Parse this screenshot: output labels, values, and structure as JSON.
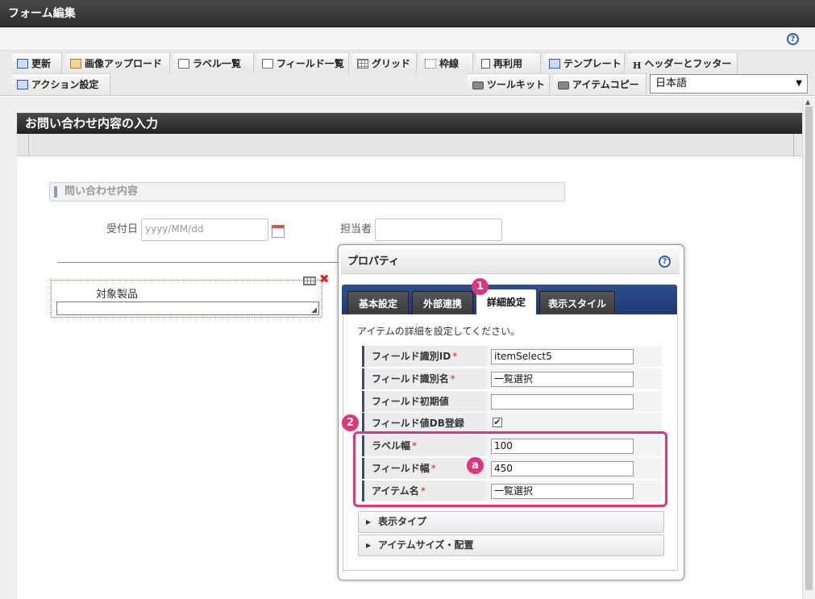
{
  "window": {
    "title": "フォーム編集"
  },
  "toolbar": {
    "row1": [
      "更新",
      "画像アップロード",
      "ラベル一覧",
      "フィールド一覧",
      "グリッド",
      "枠線",
      "再利用",
      "テンプレート",
      "ヘッダーとフッター"
    ],
    "row2_left": [
      "アクション設定"
    ],
    "row2_right": [
      "ツールキット",
      "アイテムコピー"
    ],
    "header_footer_glyph": "H",
    "language": "日本語"
  },
  "form": {
    "title": "お問い合わせ内容の入力",
    "section_title": "問い合わせ内容",
    "received_date_label": "受付日",
    "received_date_placeholder": "yyyy/MM/dd",
    "assignee_label": "担当者",
    "item_label": "対象製品"
  },
  "properties": {
    "title": "プロパティ",
    "tabs": [
      "基本設定",
      "外部連携",
      "詳細設定",
      "表示スタイル"
    ],
    "active_tab": "詳細設定",
    "description": "アイテムの詳細を設定してください。",
    "rows": [
      {
        "label": "フィールド識別ID",
        "required": true,
        "value": "itemSelect5"
      },
      {
        "label": "フィールド識別名",
        "required": true,
        "value": "一覧選択"
      },
      {
        "label": "フィールド初期値",
        "required": false,
        "value": ""
      },
      {
        "label": "フィールド値DB登録",
        "required": false,
        "checked": true
      },
      {
        "label": "ラベル幅",
        "required": true,
        "value": "100"
      },
      {
        "label": "フィールド幅",
        "required": true,
        "value": "450"
      },
      {
        "label": "アイテム名",
        "required": true,
        "value": "一覧選択"
      }
    ],
    "required_mark": "*",
    "check_mark": "✔",
    "accordions": [
      "表示タイプ",
      "アイテムサイズ・配置"
    ]
  },
  "annotations": {
    "badge1": "1",
    "badge2": "2",
    "badge_a": "a"
  },
  "icons": {
    "help": "?",
    "delete": "✖",
    "dropdown": "▼",
    "expand": "▶",
    "resize": "◢",
    "scroll_up": "▲"
  },
  "colors": {
    "annotation_pink": "#e0357a",
    "tab_bar_blue": "#2f4f8c",
    "required_red": "#d9221e"
  }
}
